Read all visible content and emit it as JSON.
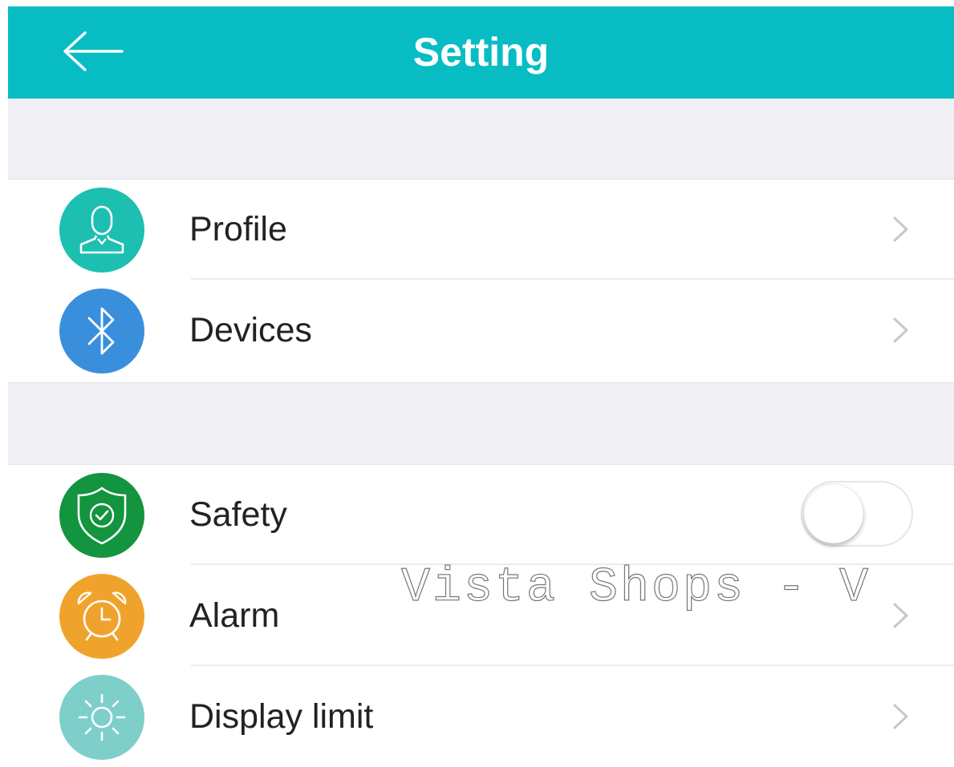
{
  "header": {
    "title": "Setting",
    "background": "#08bcc4",
    "back_icon": "arrow-left-icon"
  },
  "settings": [
    {
      "label": "Profile",
      "icon": "user-icon",
      "icon_color": "#1dbfb0",
      "control": "chevron"
    },
    {
      "label": "Devices",
      "icon": "bluetooth-icon",
      "icon_color": "#3a8fdc",
      "control": "chevron"
    },
    {
      "label": "Safety",
      "icon": "shield-check-icon",
      "icon_color": "#13943f",
      "control": "toggle",
      "toggle_on": false
    },
    {
      "label": "Alarm",
      "icon": "alarm-clock-icon",
      "icon_color": "#f0a32c",
      "control": "chevron"
    },
    {
      "label": "Display limit",
      "icon": "sun-icon",
      "icon_color": "#7ecfca",
      "control": "chevron"
    }
  ],
  "watermark": "Vista Shops - V"
}
